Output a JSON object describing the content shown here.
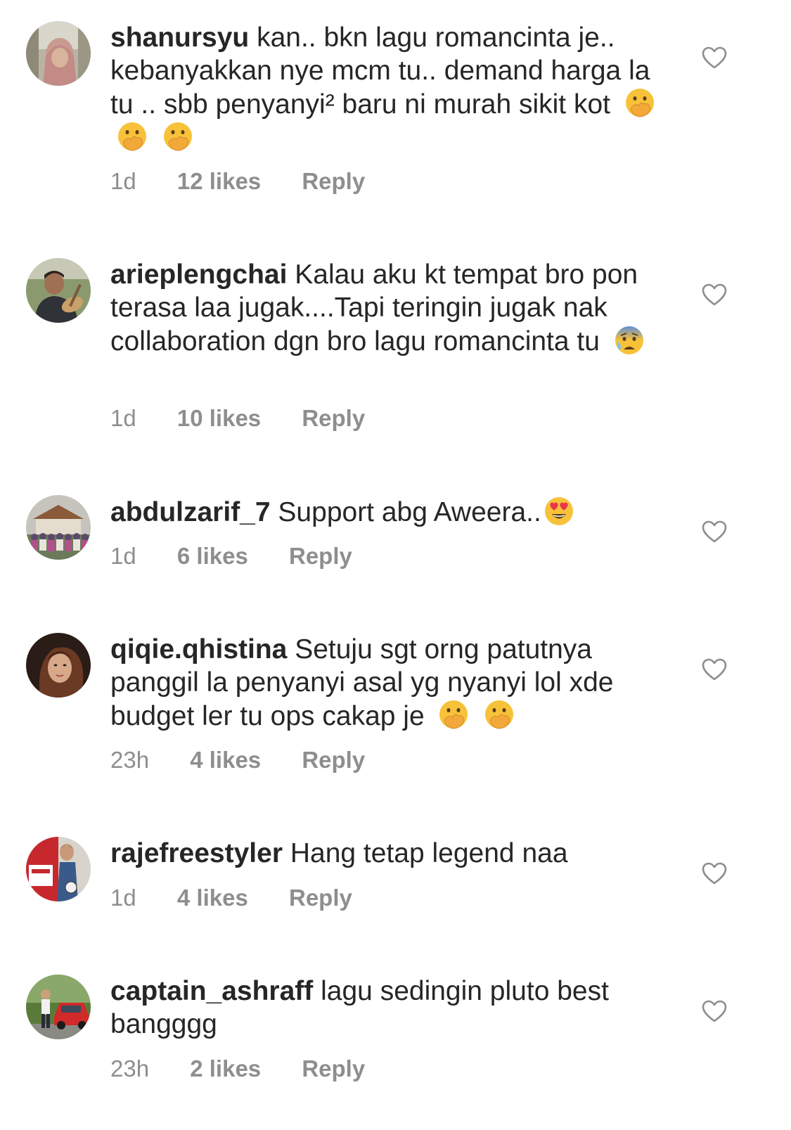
{
  "comments": [
    {
      "username": "shanursyu",
      "text": "kan.. bkn lagu romancinta je.. kebanyakkan nye mcm tu.. demand harga la tu .. sbb penyanyi² baru ni murah sikit kot",
      "emojis": [
        "hand-over-mouth-face",
        "hand-over-mouth-face",
        "hand-over-mouth-face"
      ],
      "time": "1d",
      "likes": "12 likes",
      "reply": "Reply"
    },
    {
      "username": "arieplengchai",
      "text": "Kalau aku kt tempat bro pon terasa laa jugak....Tapi teringin jugak nak collaboration dgn bro lagu romancinta tu",
      "emojis": [
        "anxious-face-with-sweat"
      ],
      "time": "1d",
      "likes": "10 likes",
      "reply": "Reply"
    },
    {
      "username": "abdulzarif_7",
      "text": "Support abg Aweera..",
      "emojis": [
        "heart-eyes-face"
      ],
      "time": "1d",
      "likes": "6 likes",
      "reply": "Reply"
    },
    {
      "username": "qiqie.qhistina",
      "text": "Setuju sgt orng patutnya panggil la penyanyi asal yg nyanyi lol xde budget ler tu ops cakap je",
      "emojis": [
        "hand-over-mouth-face",
        "hand-over-mouth-face"
      ],
      "time": "23h",
      "likes": "4 likes",
      "reply": "Reply"
    },
    {
      "username": "rajefreestyler",
      "text": "Hang tetap legend naa",
      "emojis": [],
      "time": "1d",
      "likes": "4 likes",
      "reply": "Reply"
    },
    {
      "username": "captain_ashraff",
      "text": "lagu sedingin pluto best bangggg",
      "emojis": [],
      "time": "23h",
      "likes": "2 likes",
      "reply": "Reply"
    }
  ],
  "icons": {
    "like": "heart-outline-icon"
  },
  "colors": {
    "text": "#262626",
    "secondary": "#8e8e8e",
    "emoji_yellow": "#f7c23a"
  }
}
